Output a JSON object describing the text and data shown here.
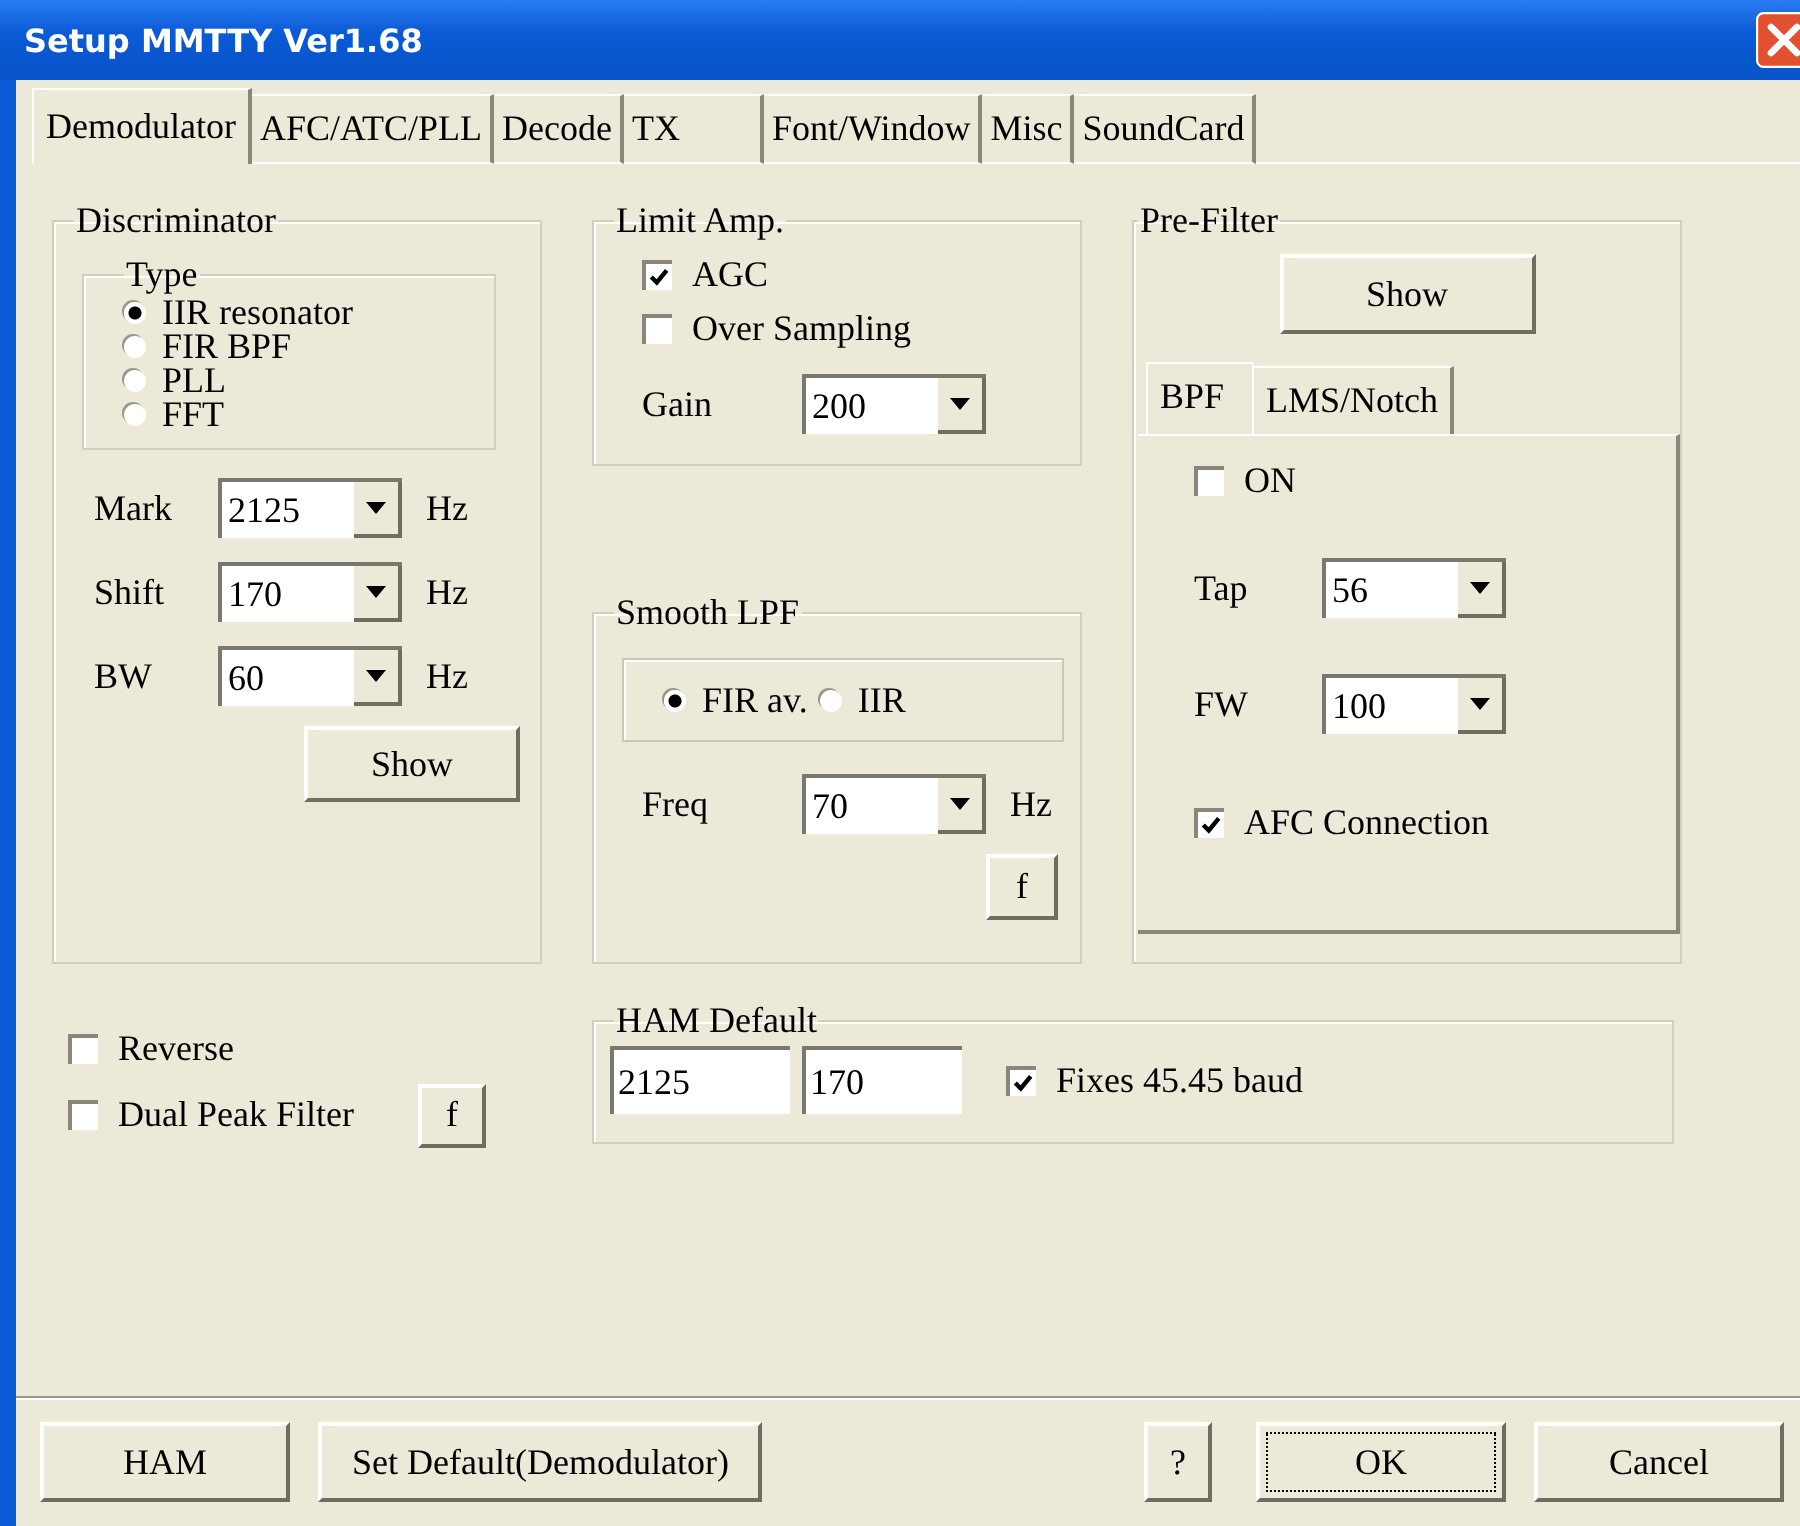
{
  "window": {
    "title": "Setup MMTTY Ver1.68"
  },
  "tabs": [
    {
      "label": "Demodulator",
      "selected": true
    },
    {
      "label": "AFC/ATC/PLL",
      "selected": false
    },
    {
      "label": "Decode",
      "selected": false
    },
    {
      "label": "TX",
      "selected": false
    },
    {
      "label": "Font/Window",
      "selected": false
    },
    {
      "label": "Misc",
      "selected": false
    },
    {
      "label": "SoundCard",
      "selected": false
    }
  ],
  "discriminator": {
    "title": "Discriminator",
    "type_group": {
      "title": "Type",
      "options": [
        {
          "label": "IIR resonator",
          "selected": true
        },
        {
          "label": "FIR BPF",
          "selected": false
        },
        {
          "label": "PLL",
          "selected": false
        },
        {
          "label": "FFT",
          "selected": false
        }
      ]
    },
    "fields": [
      {
        "label": "Mark",
        "value": "2125",
        "unit": "Hz"
      },
      {
        "label": "Shift",
        "value": "170",
        "unit": "Hz"
      },
      {
        "label": "BW",
        "value": "60",
        "unit": "Hz"
      }
    ],
    "show_button": "Show"
  },
  "limit_amp": {
    "title": "Limit Amp.",
    "checkboxes": [
      {
        "label": "AGC",
        "checked": true
      },
      {
        "label": "Over Sampling",
        "checked": false
      }
    ],
    "gain": {
      "label": "Gain",
      "value": "200"
    }
  },
  "smooth_lpf": {
    "title": "Smooth LPF",
    "options": [
      {
        "label": "FIR av.",
        "selected": true
      },
      {
        "label": "IIR",
        "selected": false
      }
    ],
    "freq": {
      "label": "Freq",
      "value": "70",
      "unit": "Hz"
    },
    "f_button": "f"
  },
  "pre_filter": {
    "title": "Pre-Filter",
    "show_button": "Show",
    "tabs": [
      {
        "label": "BPF",
        "selected": true
      },
      {
        "label": "LMS/Notch",
        "selected": false
      }
    ],
    "on": {
      "label": "ON",
      "checked": false
    },
    "fields": [
      {
        "label": "Tap",
        "value": "56"
      },
      {
        "label": "FW",
        "value": "100"
      }
    ],
    "afc": {
      "label": "AFC Connection",
      "checked": true
    }
  },
  "options": {
    "checkboxes": [
      {
        "label": "Reverse",
        "checked": false
      },
      {
        "label": "Dual Peak Filter",
        "checked": false
      }
    ],
    "f_button": "f"
  },
  "ham_default": {
    "title": "HAM Default",
    "mark": "2125",
    "shift": "170",
    "fixes": {
      "label": "Fixes 45.45 baud",
      "checked": true
    }
  },
  "left_buttons": [
    {
      "label": "HAM",
      "focused": false
    },
    {
      "label": "Set Default(Demodulator)",
      "focused": false
    }
  ],
  "right_buttons": [
    {
      "label": "?",
      "focused": false
    },
    {
      "label": "OK",
      "focused": true
    },
    {
      "label": "Cancel",
      "focused": false
    }
  ]
}
